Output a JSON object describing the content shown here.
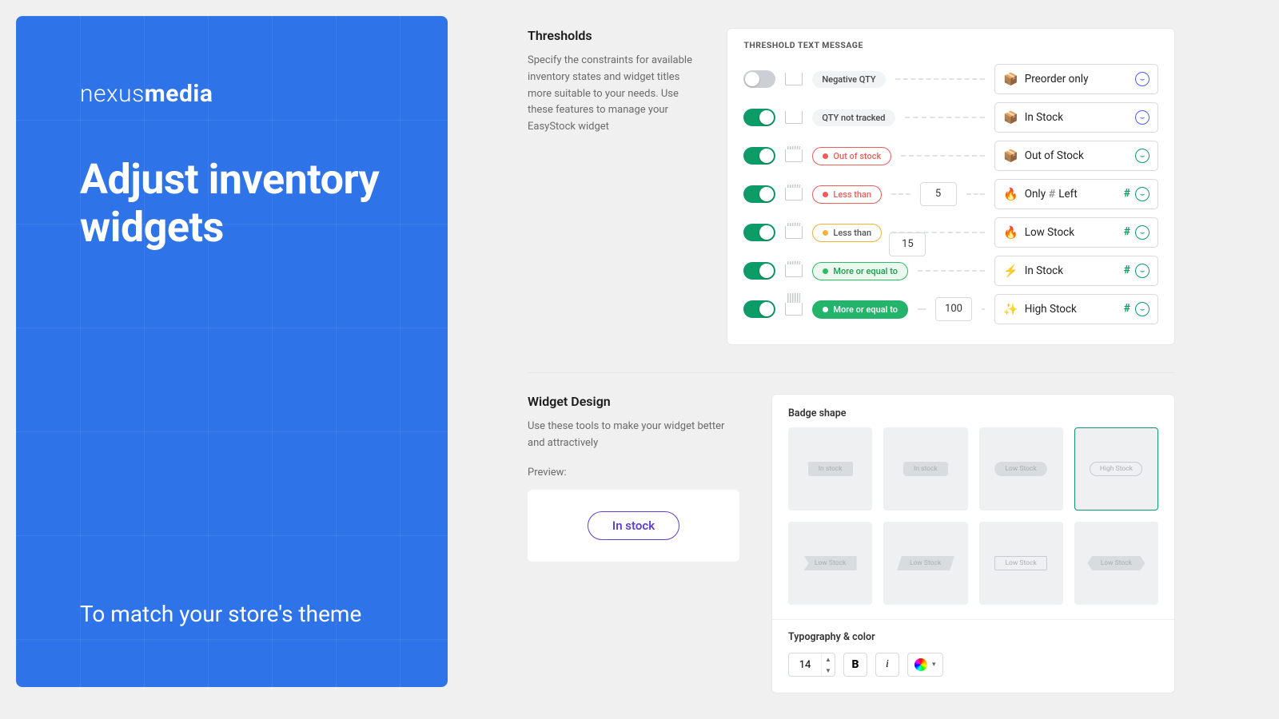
{
  "hero": {
    "logo_light": "nexus",
    "logo_bold": "media",
    "title": "Adjust inventory widgets",
    "subtitle": "To match your store's theme"
  },
  "thresholds": {
    "heading": "Thresholds",
    "desc": "Specify the constraints for available inventory states and widget titles more suitable to your needs. Use these features to manage your EasyStock widget",
    "caption": "THRESHOLD TEXT MESSAGE",
    "rows": {
      "negative": {
        "label": "Negative QTY",
        "msg": "Preorder only",
        "emoji": "📦"
      },
      "untracked": {
        "label": "QTY not tracked",
        "msg": "In Stock",
        "emoji": "📦"
      },
      "out": {
        "label": "Out of stock",
        "msg": "Out of Stock",
        "emoji": "📦"
      },
      "lt5": {
        "label": "Less than",
        "value": "5",
        "msg_prefix": "Only",
        "msg_suffix": "Left",
        "emoji": "🔥"
      },
      "lt15": {
        "label": "Less than",
        "value": "15",
        "msg": "Low Stock",
        "emoji": "🔥"
      },
      "ge15": {
        "label": "More or equal to",
        "msg": "In Stock",
        "emoji": "⚡"
      },
      "ge100": {
        "label": "More or equal to",
        "value": "100",
        "msg": "High Stock",
        "emoji": "✨"
      }
    }
  },
  "design": {
    "heading": "Widget Design",
    "desc": "Use these tools to make your widget better and attractively",
    "preview_label": "Preview:",
    "preview_text": "In stock",
    "shapes": {
      "caption": "Badge shape",
      "tiles": [
        "In stock",
        "In stock",
        "Low Stock",
        "High Stock",
        "Low Stock",
        "Low Stock",
        "Low Stock",
        "Low Stock"
      ]
    },
    "typography": {
      "caption": "Typography & color",
      "size": "14",
      "bold": "B",
      "italic": "i"
    }
  }
}
